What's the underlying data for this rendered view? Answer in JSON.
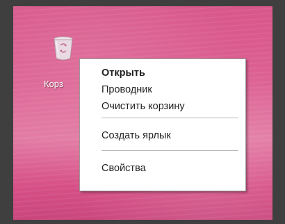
{
  "desktop": {
    "icon": {
      "name": "recycle-bin",
      "label": "Корз"
    }
  },
  "context_menu": {
    "items": [
      {
        "label": "Открыть",
        "default": true
      },
      {
        "label": "Проводник"
      },
      {
        "label": "Очистить корзину"
      },
      {
        "separator": true
      },
      {
        "label": "Создать ярлык"
      },
      {
        "separator": true
      },
      {
        "label": "Свойства"
      }
    ]
  },
  "colors": {
    "wallpaper": "#dc6192",
    "frame": "#3f3f3f",
    "menu_background": "#ffffff",
    "menu_text": "#1f1f1f",
    "separator": "#b7b7b7"
  }
}
